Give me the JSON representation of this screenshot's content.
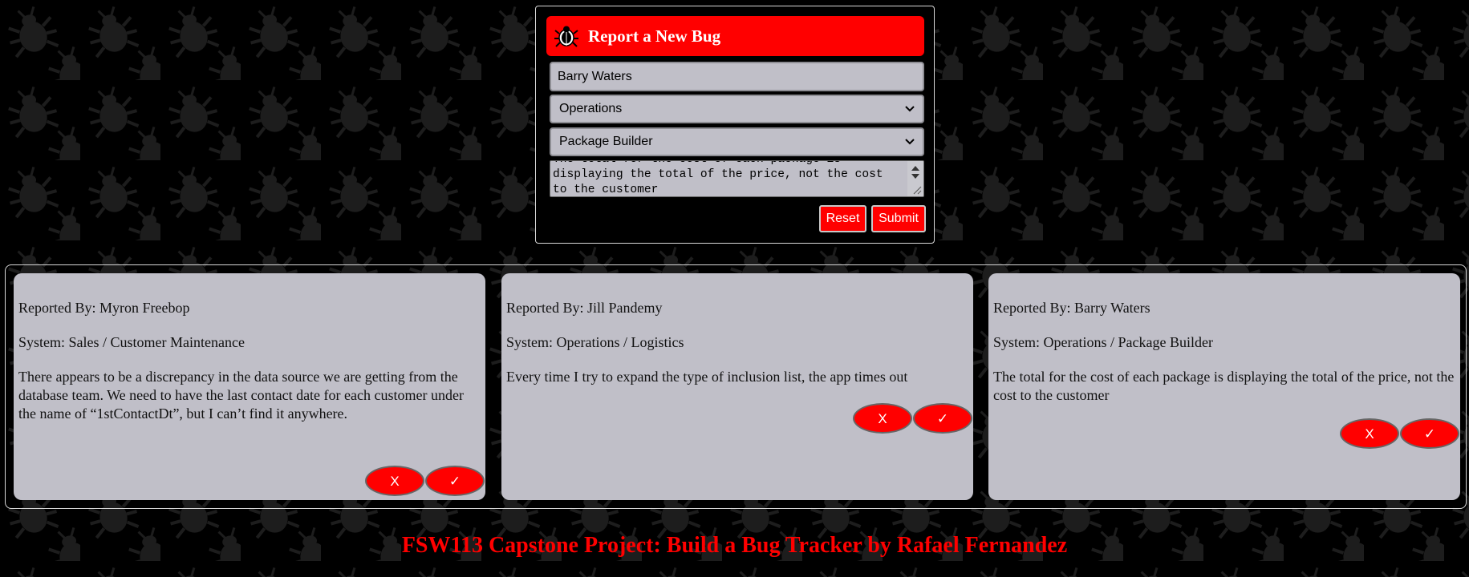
{
  "form": {
    "title": "Report a New Bug",
    "reporter_value": "Barry Waters",
    "department_selected": "Operations",
    "system_selected": "Package Builder",
    "description_value": "The total for the cost of each package is\ndisplaying the total of the price, not the cost\nto the customer",
    "reset_label": "Reset",
    "submit_label": "Submit"
  },
  "bugs": [
    {
      "reported_by": "Reported By: Myron Freebop",
      "system": "System: Sales / Customer Maintenance",
      "description": "There appears to be a discrepancy in the data source we are getting from the database team. We need to have the last contact date for each customer under the name of “1stContactDt”, but I can’t find it anywhere.",
      "delete_label": "X",
      "resolve_label": "✓"
    },
    {
      "reported_by": "Reported By: Jill Pandemy",
      "system": "System: Operations / Logistics",
      "description": "Every time I try to expand the type of inclusion list, the app times out",
      "delete_label": "X",
      "resolve_label": "✓"
    },
    {
      "reported_by": "Reported By: Barry Waters",
      "system": "System: Operations / Package Builder",
      "description": "The total for the cost of each package is displaying the total of the price, not the cost to the customer",
      "delete_label": "X",
      "resolve_label": "✓"
    }
  ],
  "footer": {
    "text": "FSW113 Capstone Project: Build a Bug Tracker by Rafael Fernandez"
  },
  "colors": {
    "accent": "#ff0000",
    "card_bg": "#c0bfc8",
    "page_bg": "#000000"
  }
}
